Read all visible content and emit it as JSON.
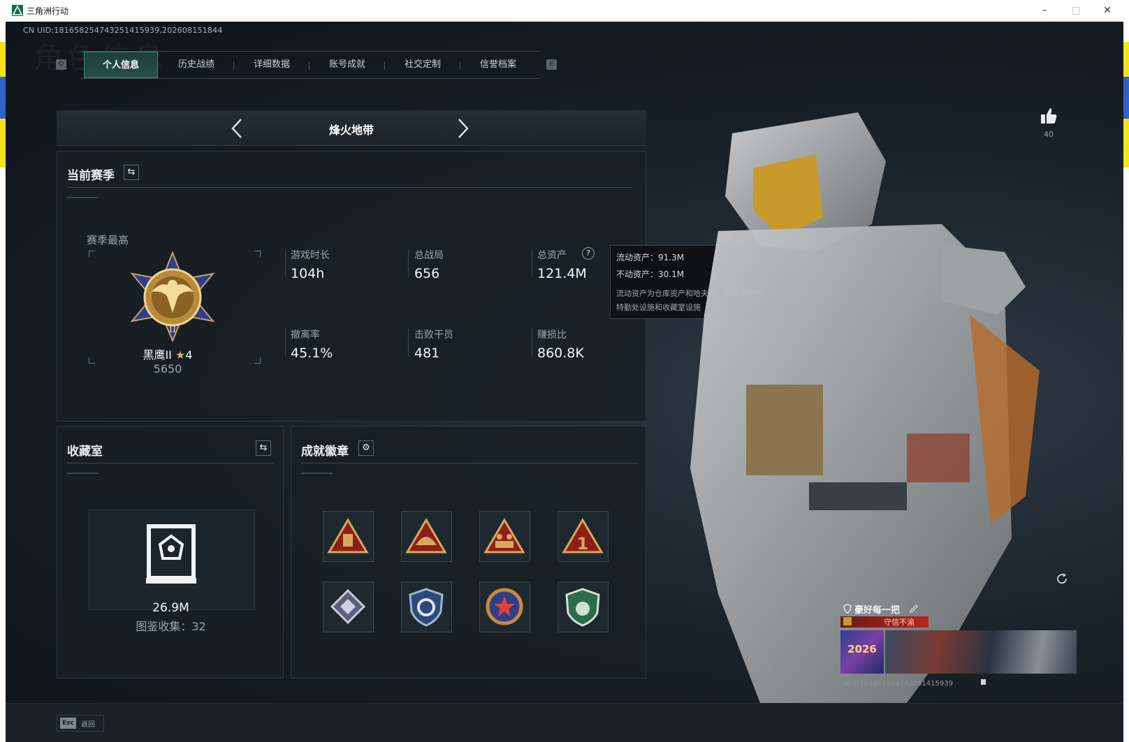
{
  "window": {
    "title": "三角洲行动",
    "minimize": "–",
    "maximize": "□",
    "close": "✕"
  },
  "uid": "CN UID:1816582547432514159​39,202608151844",
  "background_watermark": "角色信息",
  "tabs": {
    "left_key": "Q",
    "right_key": "E",
    "items": [
      {
        "label": "个人信息",
        "active": true
      },
      {
        "label": "历史战绩",
        "active": false
      },
      {
        "label": "详细数据",
        "active": false
      },
      {
        "label": "账号成就",
        "active": false
      },
      {
        "label": "社交定制",
        "active": false
      },
      {
        "label": "信誉档案",
        "active": false
      }
    ]
  },
  "mode": {
    "title": "烽火地带",
    "prev": "‹",
    "next": "›"
  },
  "season": {
    "title": "当前赛季",
    "switch_icon": "⇆",
    "best_label": "赛季最高",
    "rank_name": "黑鹰II",
    "rank_stars": "4",
    "rank_score": "5650",
    "stats": [
      {
        "label": "游戏时长",
        "value": "104h"
      },
      {
        "label": "总战局",
        "value": "656"
      },
      {
        "label": "总资产",
        "value": "121.4M"
      },
      {
        "label": "撤离率",
        "value": "45.1%"
      },
      {
        "label": "击败干员",
        "value": "481"
      },
      {
        "label": "赚损比",
        "value": "860.8K"
      }
    ],
    "help_icon": "?"
  },
  "tooltip": {
    "liquid": "流动资产：91.3M",
    "fixed": "不动资产：30.1M",
    "desc_line1": "流动资产为仓库资产和哈夫币，不动资产为",
    "desc_line2": "特勤处设施和收藏室设施"
  },
  "collection": {
    "title": "收藏室",
    "switch_icon": "⇆",
    "value": "26.9M",
    "catalog": "图鉴收集：32"
  },
  "badges": {
    "title": "成就徽章",
    "settings_icon": "⚙",
    "row1": [
      "warning-triangle-badge",
      "helmet-triangle-badge",
      "soldiers-triangle-badge",
      "number-one-triangle-badge"
    ],
    "row2": [
      "diamond-badge",
      "cycle-shield-badge",
      "star-wreath-badge",
      "green-shield-badge"
    ]
  },
  "likes": {
    "count": "40"
  },
  "name_card": {
    "player_name": "豪好每一把",
    "title": "守信不渝",
    "banner_text": "2026",
    "id_text": "编号:1816582547432514159​39"
  },
  "footer": {
    "esc_key": "Esc",
    "back_label": "返回"
  },
  "colors": {
    "accent_green": "#3f8e7c",
    "gold": "#d7b35a",
    "desktop_yellow": "#f5e21b",
    "desktop_blue": "#2b63c9"
  }
}
